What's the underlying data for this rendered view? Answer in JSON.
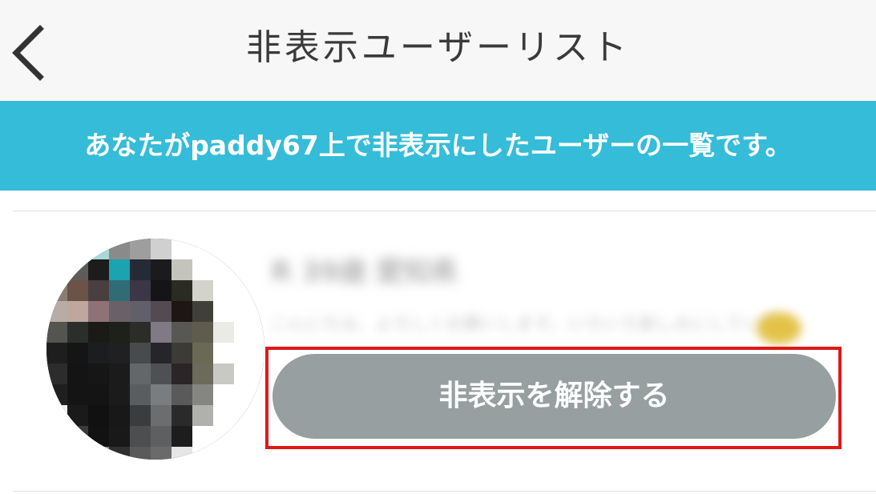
{
  "header": {
    "title": "非表示ユーザーリスト",
    "back_icon": "chevron-left-icon"
  },
  "banner": {
    "message": "あなたがpaddy67上で非表示にしたユーザーの一覧です。",
    "color": "#35bcd8"
  },
  "hidden_users": [
    {
      "name": "R 39歳 愛知県",
      "bio": "こんにちは、よろしくお願いします。いろいろ楽しみにしています",
      "unhide_label": "非表示を解除する"
    }
  ],
  "colors": {
    "button_bg": "#979fa0",
    "highlight_border": "#e01818",
    "header_bg": "#f7f7f7"
  }
}
